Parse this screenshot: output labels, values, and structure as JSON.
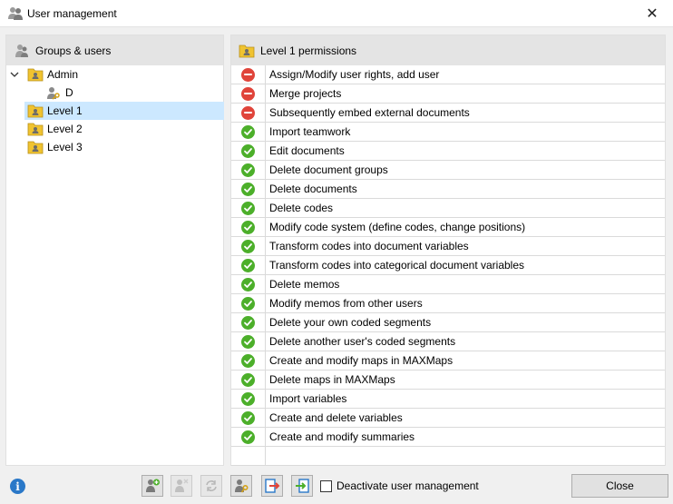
{
  "window": {
    "title": "User management",
    "close_glyph": "✕"
  },
  "left_panel": {
    "header": "Groups & users",
    "tree": [
      {
        "label": "Admin",
        "type": "group",
        "expanded": true,
        "selected": false
      },
      {
        "label": "D",
        "type": "user",
        "selected": false
      },
      {
        "label": "Level 1",
        "type": "group",
        "selected": true
      },
      {
        "label": "Level 2",
        "type": "group",
        "selected": false
      },
      {
        "label": "Level 3",
        "type": "group",
        "selected": false
      }
    ]
  },
  "right_panel": {
    "header": "Level 1 permissions",
    "permissions": [
      {
        "label": "Assign/Modify user rights, add user",
        "allowed": false
      },
      {
        "label": "Merge projects",
        "allowed": false
      },
      {
        "label": "Subsequently embed external documents",
        "allowed": false
      },
      {
        "label": "Import teamwork",
        "allowed": true
      },
      {
        "label": "Edit documents",
        "allowed": true
      },
      {
        "label": "Delete document groups",
        "allowed": true
      },
      {
        "label": "Delete documents",
        "allowed": true
      },
      {
        "label": "Delete codes",
        "allowed": true
      },
      {
        "label": "Modify code system (define codes, change positions)",
        "allowed": true
      },
      {
        "label": "Transform codes into document variables",
        "allowed": true
      },
      {
        "label": "Transform codes into categorical document variables",
        "allowed": true
      },
      {
        "label": "Delete memos",
        "allowed": true
      },
      {
        "label": "Modify memos from other users",
        "allowed": true
      },
      {
        "label": "Delete your own coded segments",
        "allowed": true
      },
      {
        "label": "Delete another user's coded segments",
        "allowed": true
      },
      {
        "label": "Create and modify maps in MAXMaps",
        "allowed": true
      },
      {
        "label": "Delete maps in MAXMaps",
        "allowed": true
      },
      {
        "label": "Import variables",
        "allowed": true
      },
      {
        "label": "Create and delete variables",
        "allowed": true
      },
      {
        "label": "Create and modify summaries",
        "allowed": true
      }
    ]
  },
  "bottom": {
    "info_glyph": "i",
    "toolbar": [
      {
        "name": "add-user-button",
        "icon": "add-user-icon",
        "enabled": true
      },
      {
        "name": "delete-user-button",
        "icon": "delete-user-icon",
        "enabled": false
      },
      {
        "name": "reset-password-button",
        "icon": "refresh-icon",
        "enabled": false
      },
      {
        "name": "set-password-button",
        "icon": "key-user-icon",
        "enabled": true
      },
      {
        "name": "export-users-button",
        "icon": "export-icon",
        "enabled": true
      },
      {
        "name": "import-users-button",
        "icon": "import-icon",
        "enabled": true
      }
    ],
    "deactivate_label": "Deactivate user management",
    "deactivate_checked": false,
    "close_label": "Close"
  },
  "colors": {
    "selection": "#cce8ff",
    "denied": "#e0443a",
    "granted": "#4caf2a",
    "header_bg": "#e4e4e4",
    "info": "#2a78c8"
  }
}
